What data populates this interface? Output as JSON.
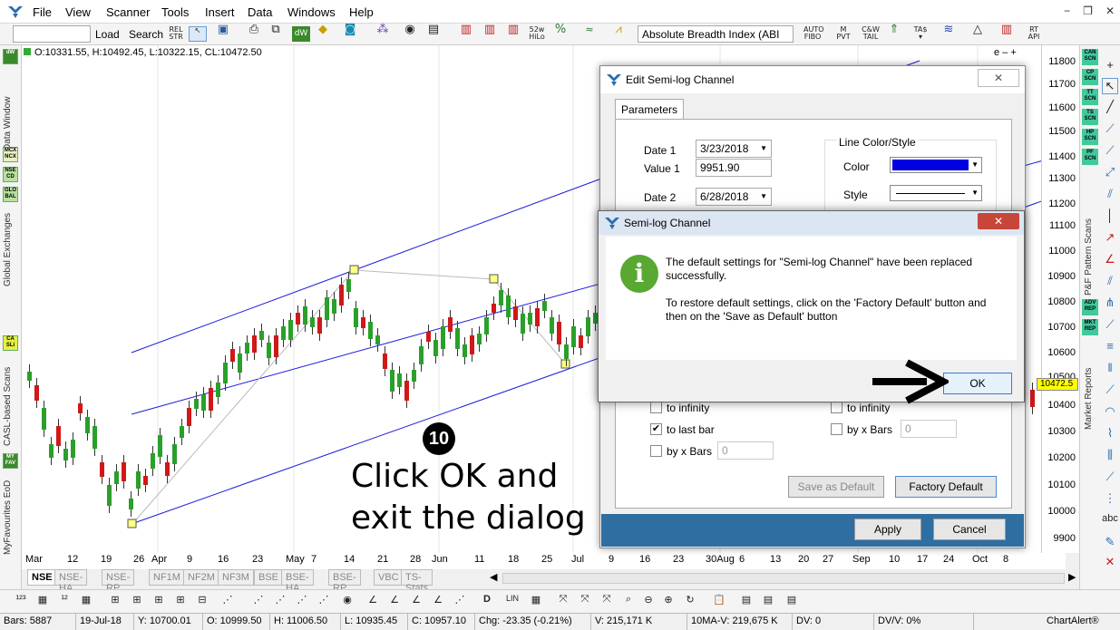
{
  "menu": {
    "items": [
      "File",
      "View",
      "Scanner",
      "Tools",
      "Insert",
      "Data",
      "Windows",
      "Help"
    ]
  },
  "window_controls": [
    "−",
    "❐",
    "✕"
  ],
  "toolbar": {
    "load_label": "Load",
    "search_label": "Search",
    "indicator_combo": "Absolute Breadth Index (ABI",
    "icons": [
      "REL STR",
      "52w HiLo",
      "AUTO FIBO",
      "M PVT",
      "C&W TAIL",
      "TA$ ▾",
      "RT API"
    ]
  },
  "chart": {
    "ohlc_info": "O:10331.55, H:10492.45, L:10322.15, CL:10472.50",
    "mini_controls": "e – +",
    "current_price": "10472.5",
    "y_ticks": [
      "11800",
      "11700",
      "11600",
      "11500",
      "11400",
      "11300",
      "11200",
      "11100",
      "11000",
      "10900",
      "10800",
      "10700",
      "10600",
      "10500",
      "10400",
      "10300",
      "10200",
      "10100",
      "10000",
      "9900"
    ],
    "x_ticks": [
      "Mar",
      "12",
      "19",
      "26",
      "Apr",
      "9",
      "16",
      "23",
      "May",
      "7",
      "14",
      "21",
      "28",
      "Jun",
      "11",
      "18",
      "25",
      "Jul",
      "9",
      "16",
      "23",
      "30Aug",
      "6",
      "13",
      "20",
      "27",
      "Sep",
      "10",
      "17",
      "24",
      "Oct",
      "8"
    ]
  },
  "left_sidebar": {
    "tabs": [
      "Data Window",
      "Global Exchanges",
      "CASL-based Scans",
      "MyFavourites EoD"
    ],
    "icons": [
      "dW",
      "MCX NCX",
      "NSE CD",
      "GLO BAL",
      "CA SLi",
      "MY FAV"
    ]
  },
  "right_sidebar": {
    "tabs": [
      "P&F Pattern Scans",
      "Market Reports"
    ],
    "icons": [
      "CAN SCN",
      "CP SCN",
      "TT SCN",
      "TS SCN",
      "HP SCN",
      "PF SCN",
      "ADV REP",
      "MKT REP"
    ]
  },
  "bottom_tabs": [
    "NSE",
    "NSE-HA",
    "NSE-RP",
    "NF1M",
    "NF2M",
    "NF3M",
    "BSE",
    "BSE-HA",
    "BSE-RP",
    "VBC",
    "TS-Stats"
  ],
  "status": {
    "bars": "Bars: 5887",
    "date": "19-Jul-18",
    "y": "Y: 10700.01",
    "o": "O: 10999.50",
    "h": "H: 11006.50",
    "l": "L: 10935.45",
    "c": "C: 10957.10",
    "chg": "Chg: -23.35 (-0.21%)",
    "v": "V: 215,171 K",
    "ma": "10MA-V: 219,675 K",
    "dv": "DV: 0",
    "dvv": "DV/V: 0%",
    "brand": "ChartAlert®"
  },
  "edit_dialog": {
    "title": "Edit Semi-log Channel",
    "tab": "Parameters",
    "date1_label": "Date 1",
    "date1_value": "3/23/2018",
    "value1_label": "Value 1",
    "value1_value": "9951.90",
    "date2_label": "Date 2",
    "date2_value": "6/28/2018",
    "line_group": "Line Color/Style",
    "color_label": "Color",
    "style_label": "Style",
    "to_infinity": "to infinity",
    "to_infinity_right": "to infinity",
    "to_last_bar": "to last bar",
    "by_x_bars": "by x Bars",
    "by_x_bars_right": "by x Bars",
    "bars_value": "0",
    "bars_value_right": "0",
    "save_default": "Save as Default",
    "factory_default": "Factory Default",
    "apply": "Apply",
    "cancel": "Cancel",
    "line_color": "#0000e0"
  },
  "message_dialog": {
    "title": "Semi-log Channel",
    "message1": "The default settings for \"Semi-log Channel\" have been replaced successfully.",
    "message2": "To restore default settings, click on the 'Factory Default' button and then on the 'Save as Default' button",
    "ok": "OK"
  },
  "annotation": {
    "step": "10",
    "line1": "Click OK and",
    "line2": "exit the dialog"
  }
}
